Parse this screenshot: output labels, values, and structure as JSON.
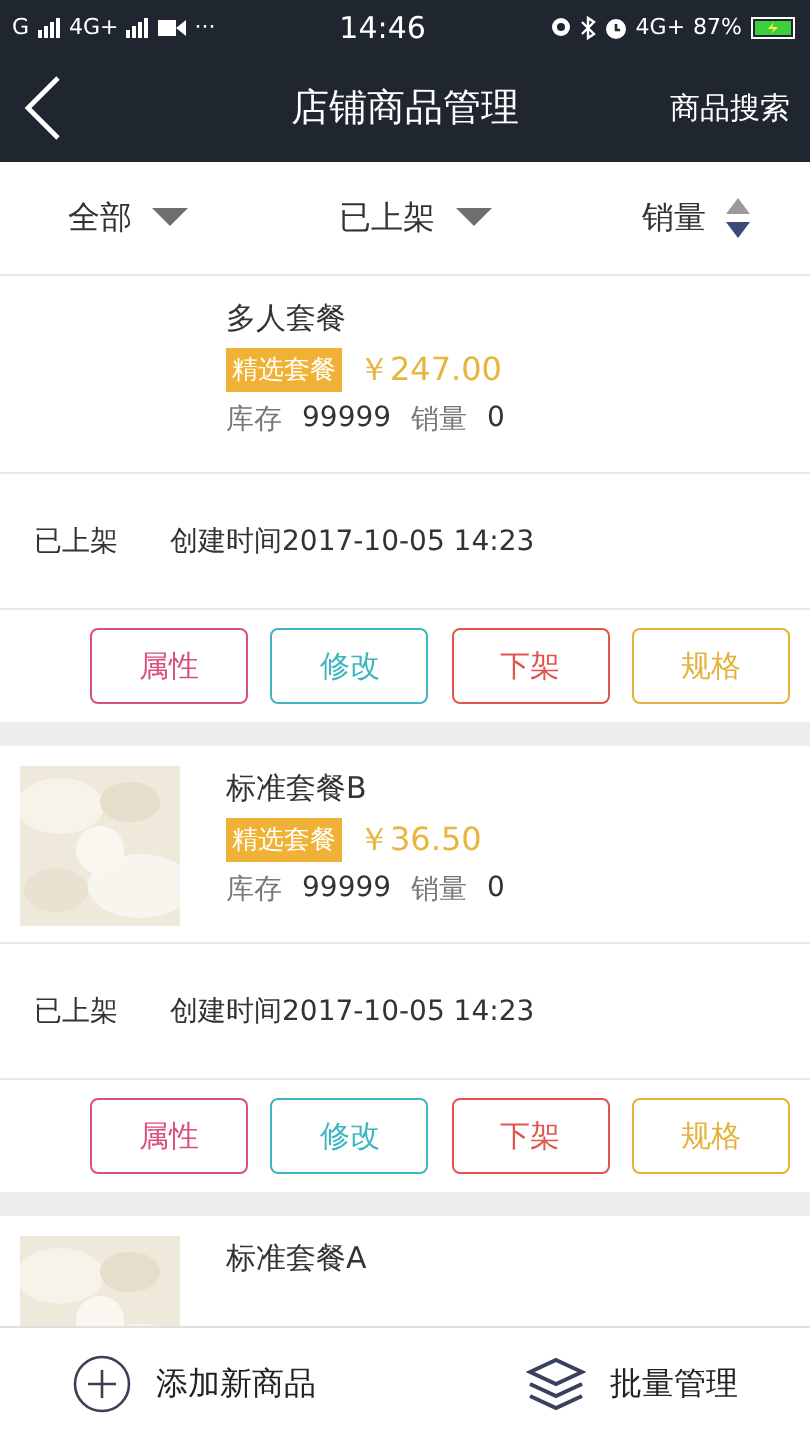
{
  "status_bar": {
    "carrier_1": "G",
    "carrier_2": "4G+",
    "more": "···",
    "time": "14:46",
    "network": "4G+",
    "battery": "87%",
    "charging": true
  },
  "header": {
    "title": "店铺商品管理",
    "action": "商品搜索"
  },
  "filters": [
    {
      "label": "全部",
      "kind": "dropdown"
    },
    {
      "label": "已上架",
      "kind": "dropdown"
    },
    {
      "label": "销量",
      "kind": "sort",
      "descending": true
    }
  ],
  "products": [
    {
      "name": "多人套餐",
      "thumbnail": false,
      "tag": "精选套餐",
      "price": "￥247.00",
      "stock_label": "库存",
      "stock": "99999",
      "sales_label": "销量",
      "sales": "0",
      "status": "已上架",
      "created": "创建时间2017-10-05 14:23",
      "actions": [
        {
          "label": "属性",
          "color": "#d9507a"
        },
        {
          "label": "修改",
          "color": "#3fb6bf"
        },
        {
          "label": "下架",
          "color": "#e0564e"
        },
        {
          "label": "规格",
          "color": "#e4b23a"
        }
      ]
    },
    {
      "name": "标准套餐B",
      "thumbnail": true,
      "tag": "精选套餐",
      "price": "￥36.50",
      "stock_label": "库存",
      "stock": "99999",
      "sales_label": "销量",
      "sales": "0",
      "status": "已上架",
      "created": "创建时间2017-10-05 14:23",
      "actions": [
        {
          "label": "属性",
          "color": "#d9507a"
        },
        {
          "label": "修改",
          "color": "#3fb6bf"
        },
        {
          "label": "下架",
          "color": "#e0564e"
        },
        {
          "label": "规格",
          "color": "#e4b23a"
        }
      ]
    },
    {
      "name": "标准套餐A",
      "thumbnail": true
    }
  ],
  "bottom_bar": {
    "add": "添加新商品",
    "batch": "批量管理"
  }
}
